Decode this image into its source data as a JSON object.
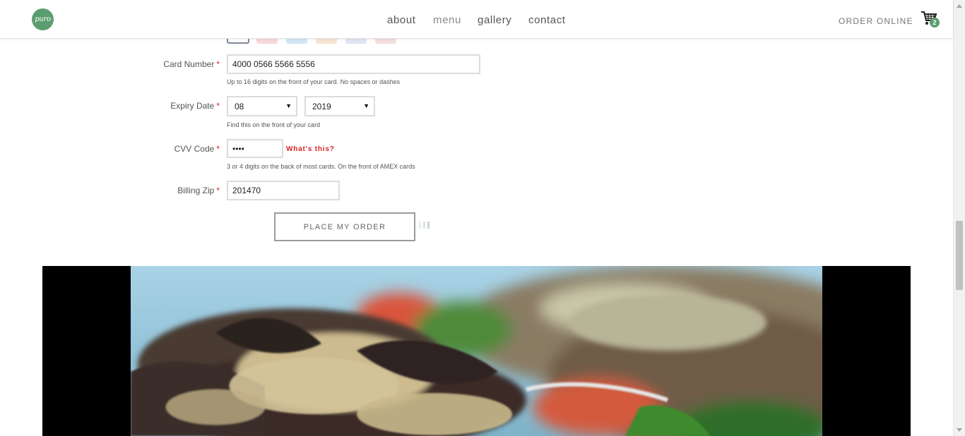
{
  "header": {
    "logo_text": "puro",
    "nav": [
      {
        "label": "about"
      },
      {
        "label": "menu"
      },
      {
        "label": "gallery"
      },
      {
        "label": "contact"
      }
    ],
    "order_online": "ORDER ONLINE",
    "cart_count": "2"
  },
  "form": {
    "card_number": {
      "label": "Card Number",
      "required": "*",
      "value": "4000 0566 5566 5556",
      "hint": "Up to 16 digits on the front of your card. No spaces or dashes"
    },
    "expiry": {
      "label": "Expiry Date",
      "required": "*",
      "month": "08",
      "year": "2019",
      "hint": "Find this on the front of your card"
    },
    "cvv": {
      "label": "CVV Code",
      "required": "*",
      "value": "••••",
      "help_link": "What's this?",
      "hint": "3 or 4 digits on the back of most cards. On the front of AMEX cards"
    },
    "zip": {
      "label": "Billing Zip",
      "required": "*",
      "value": "201470"
    },
    "submit_label": "PLACE MY ORDER"
  },
  "colors": {
    "brand_green": "#5a9e6f",
    "required_red": "#dd2222"
  }
}
